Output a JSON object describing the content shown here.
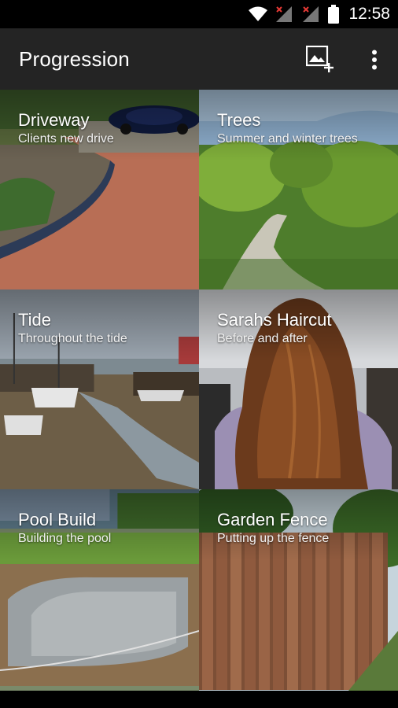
{
  "status_bar": {
    "time": "12:58",
    "icons": [
      "wifi-icon",
      "signal-no-service-icon",
      "signal-no-service-icon",
      "battery-icon"
    ]
  },
  "app_bar": {
    "title": "Progression",
    "actions": [
      "add-image-icon",
      "more-vert-icon"
    ]
  },
  "projects": [
    {
      "title": "Driveway",
      "subtitle": "Clients new drive"
    },
    {
      "title": "Trees",
      "subtitle": "Summer and winter trees"
    },
    {
      "title": "Tide",
      "subtitle": "Throughout the tide"
    },
    {
      "title": "Sarahs Haircut",
      "subtitle": "Before and after"
    },
    {
      "title": "Pool Build",
      "subtitle": "Building the pool"
    },
    {
      "title": "Garden Fence",
      "subtitle": "Putting up the fence"
    }
  ],
  "colors": {
    "app_bar": "#242424",
    "status_bar": "#000000",
    "no_service_mark": "#e53935"
  }
}
